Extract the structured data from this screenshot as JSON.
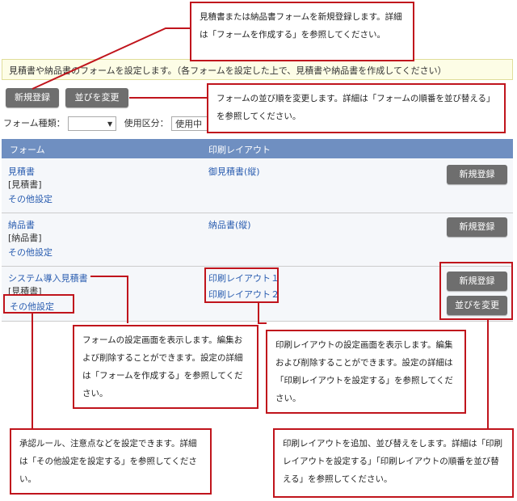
{
  "notice": "見積書や納品書のフォームを設定します。（各フォームを設定した上で、見積書や納品書を作成してください）",
  "toolbar": {
    "new_label": "新規登録",
    "order_label": "並びを変更"
  },
  "filter": {
    "type_label": "フォーム種類：",
    "type_value": "",
    "usage_label": "使用区分：",
    "usage_value": "使用中"
  },
  "table": {
    "headers": [
      "フォーム",
      "印刷レイアウト"
    ],
    "rows": [
      {
        "form_name": "見積書",
        "form_type": "[見積書]",
        "settings": "その他設定",
        "layouts": [
          "御見積書(縦)"
        ],
        "buttons": [
          "新規登録"
        ]
      },
      {
        "form_name": "納品書",
        "form_type": "[納品書]",
        "settings": "その他設定",
        "layouts": [
          "納品書(縦)"
        ],
        "buttons": [
          "新規登録"
        ]
      },
      {
        "form_name": "システム導入見積書",
        "form_type": "[見積書]",
        "settings": "その他設定",
        "layouts": [
          "印刷レイアウト１",
          "印刷レイアウト２"
        ],
        "buttons": [
          "新規登録",
          "並びを変更"
        ]
      }
    ]
  },
  "callouts": {
    "new_form": "見積書または納品書フォームを新規登録します。詳細は「フォームを作成する」を参照してください。",
    "reorder": "フォームの並び順を変更します。詳細は「フォームの順番を並び替える」を参照してください。",
    "form_settings": "フォームの設定画面を表示します。編集および削除することができます。設定の詳細は「フォームを作成する」を参照してください。",
    "layout_settings": "印刷レイアウトの設定画面を表示します。編集および削除することができます。設定の詳細は「印刷レイアウトを設定する」を参照してください。",
    "other_settings": "承認ルール、注意点などを設定できます。詳細は「その他設定を設定する」を参照してください。",
    "layout_add": "印刷レイアウトを追加、並び替えをします。詳細は「印刷レイアウトを設定する」「印刷レイアウトの順番を並び替える」を参照してください。"
  }
}
